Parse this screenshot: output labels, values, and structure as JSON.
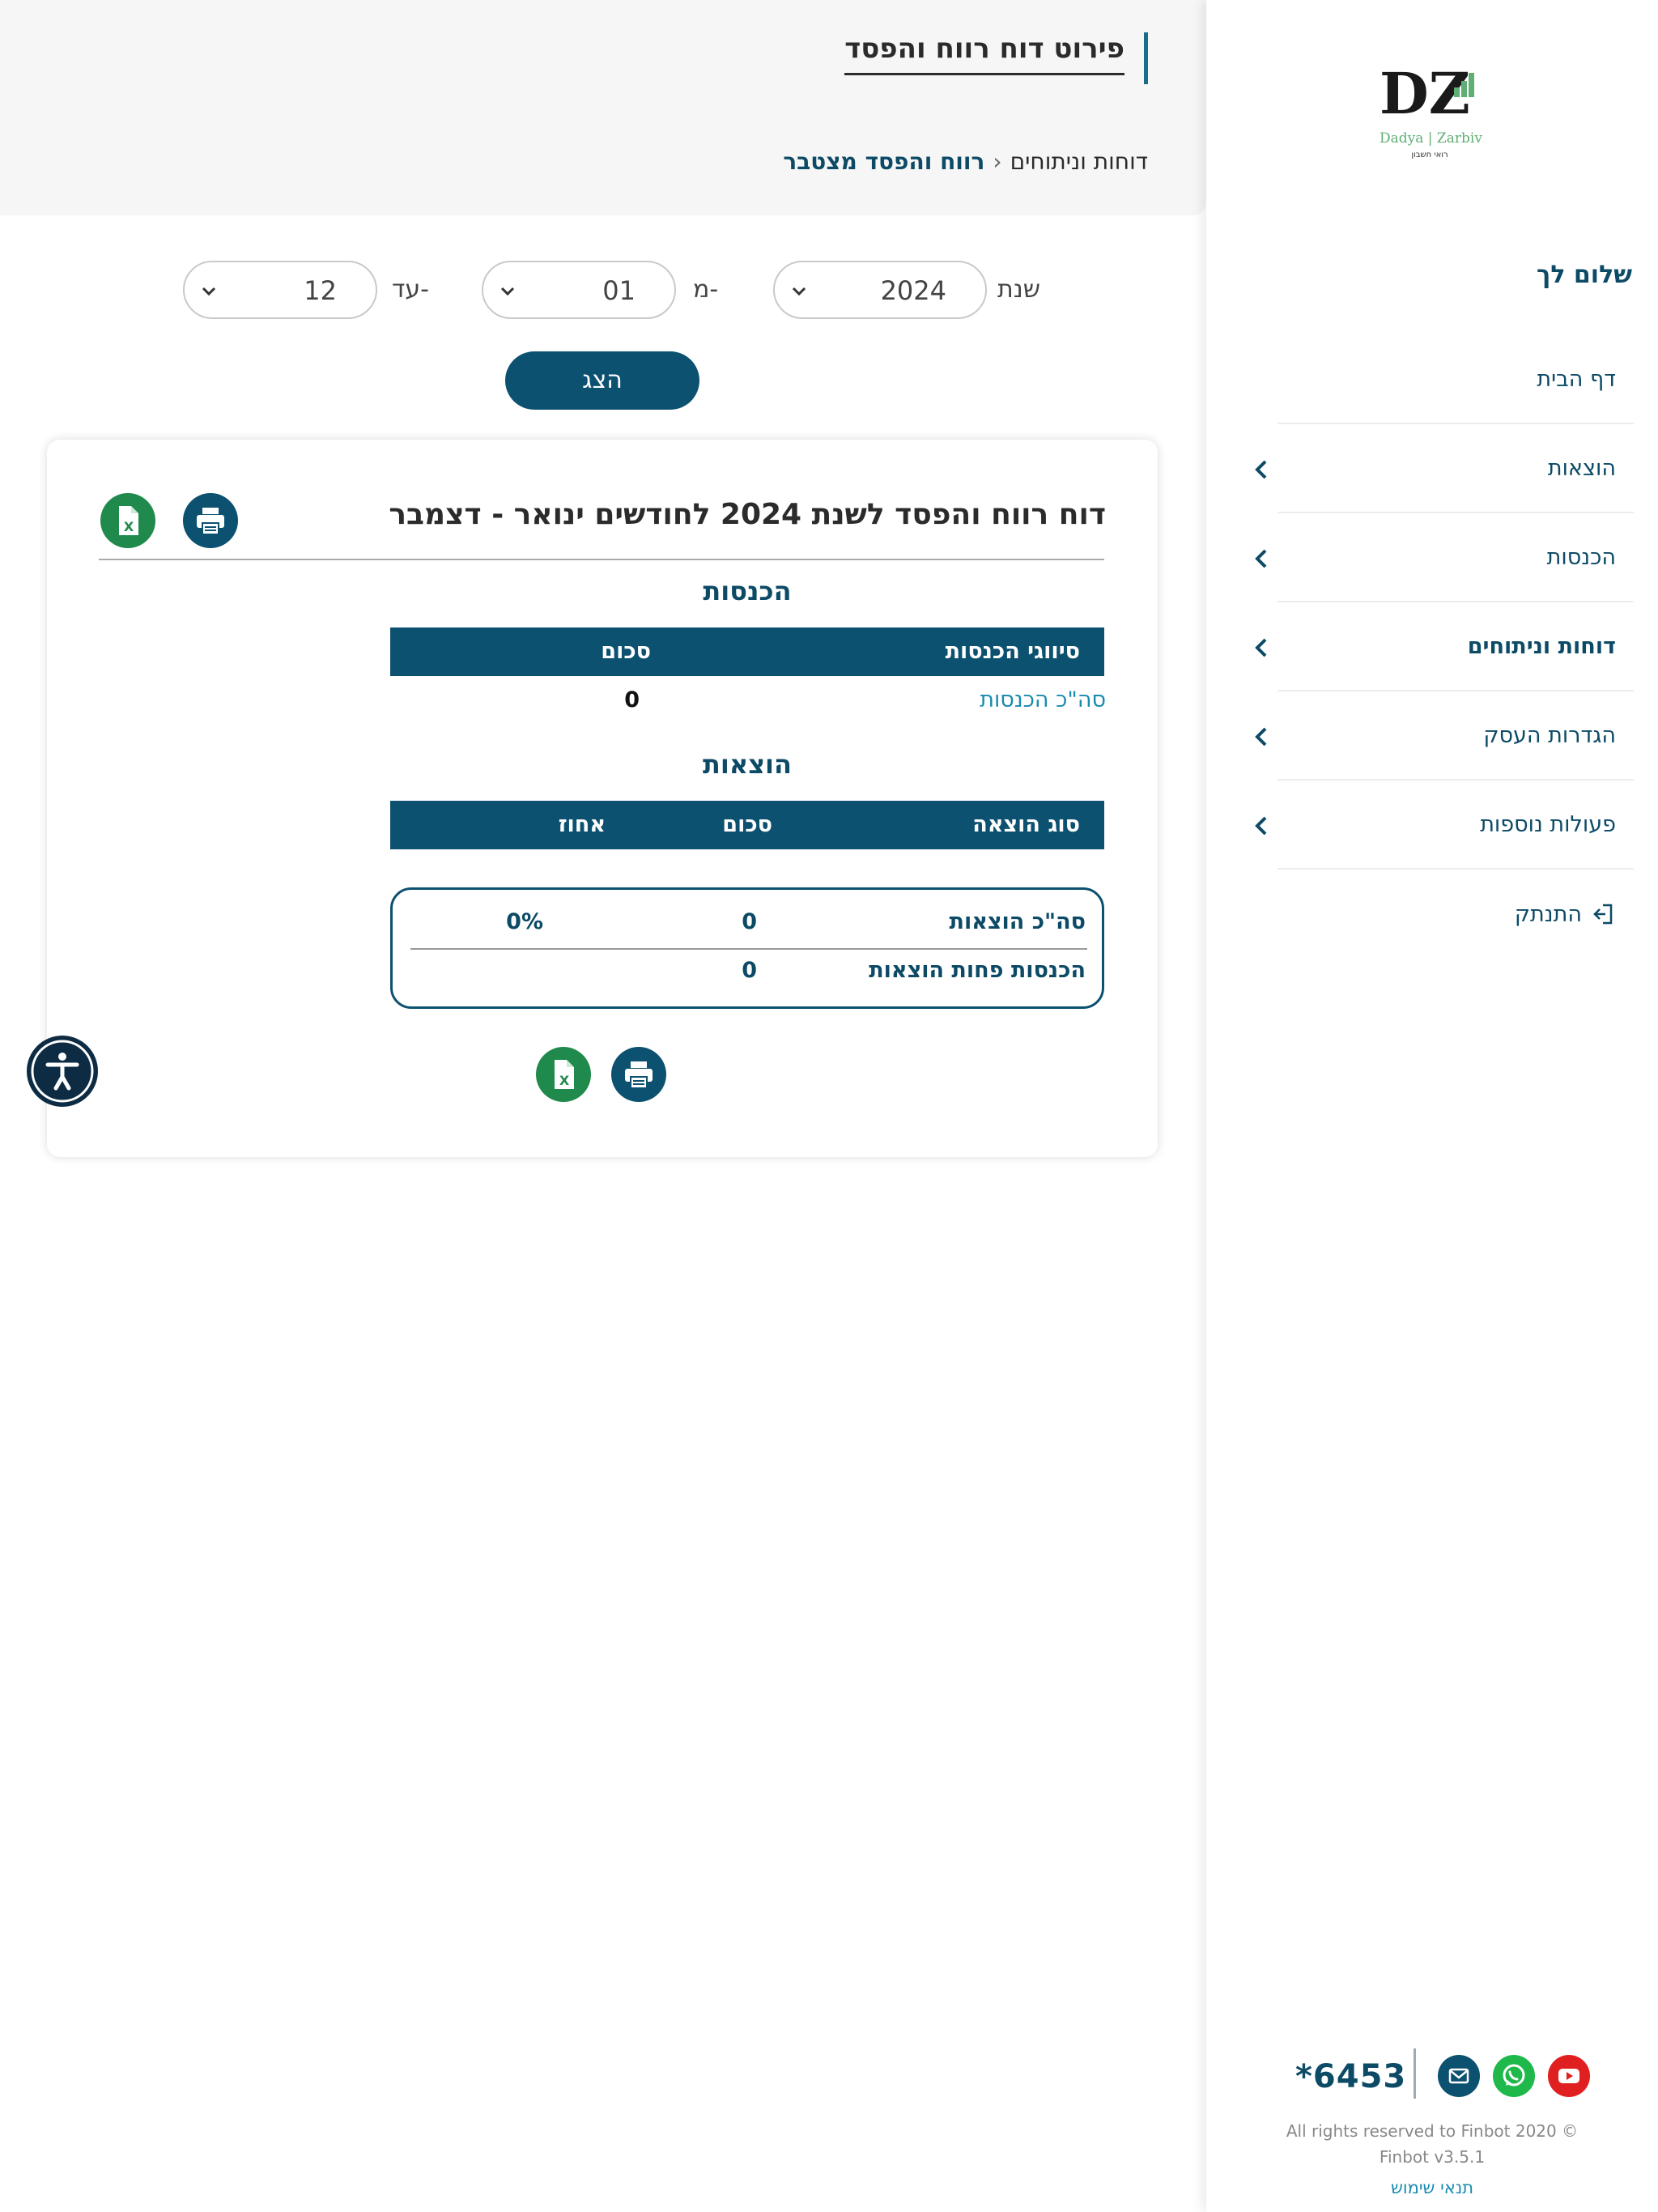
{
  "header": {
    "title": "פירוט דוח רווח והפסד",
    "breadcrumb": {
      "parent": "דוחות וניתוחים",
      "separator": "›",
      "current": "רווח והפסד מצטבר"
    }
  },
  "filters": {
    "year_label": "שנת",
    "year_value": "2024",
    "from_label": "מ-",
    "from_value": "01",
    "to_label": "עד-",
    "to_value": "12",
    "show_button": "הצג"
  },
  "report": {
    "title": "דוח רווח והפסד לשנת 2024 לחודשים ינואר - דצמבר",
    "income": {
      "section_title": "הכנסות",
      "col_type": "סיווגי הכנסות",
      "col_amount": "סכום",
      "total_label": "סה\"כ הכנסות",
      "total_value": "0"
    },
    "expenses": {
      "section_title": "הוצאות",
      "col_type": "סוג הוצאה",
      "col_amount": "סכום",
      "col_percent": "אחוז",
      "total_label": "סה\"כ הוצאות",
      "total_value": "0",
      "total_percent": "0%",
      "net_label": "הכנסות פחות הוצאות",
      "net_value": "0"
    }
  },
  "sidebar": {
    "greeting": "שלום לך",
    "items": [
      {
        "label": "דף הבית"
      },
      {
        "label": "הוצאות"
      },
      {
        "label": "הכנסות"
      },
      {
        "label": "דוחות וניתוחים"
      },
      {
        "label": "הגדרות העסק"
      },
      {
        "label": "פעולות נוספות"
      },
      {
        "label": "התנתק"
      }
    ],
    "logo": {
      "letters": "DZ",
      "name": "Dadya | Zarbiv",
      "subtitle": "רואי חשבון"
    },
    "phone": "*6453",
    "rights": "All rights reserved to Finbot 2020 ©",
    "version": "Finbot v3.5.1",
    "terms": "תנאי שימוש"
  },
  "colors": {
    "primary": "#0c5170",
    "excel": "#1f8a4c",
    "whatsapp": "#1fb84a",
    "youtube": "#e02020"
  },
  "icons": [
    "print-icon",
    "excel-icon",
    "chevron-left-icon",
    "chevron-down-icon",
    "logout-icon",
    "mail-icon",
    "whatsapp-icon",
    "youtube-icon",
    "accessibility-icon"
  ]
}
